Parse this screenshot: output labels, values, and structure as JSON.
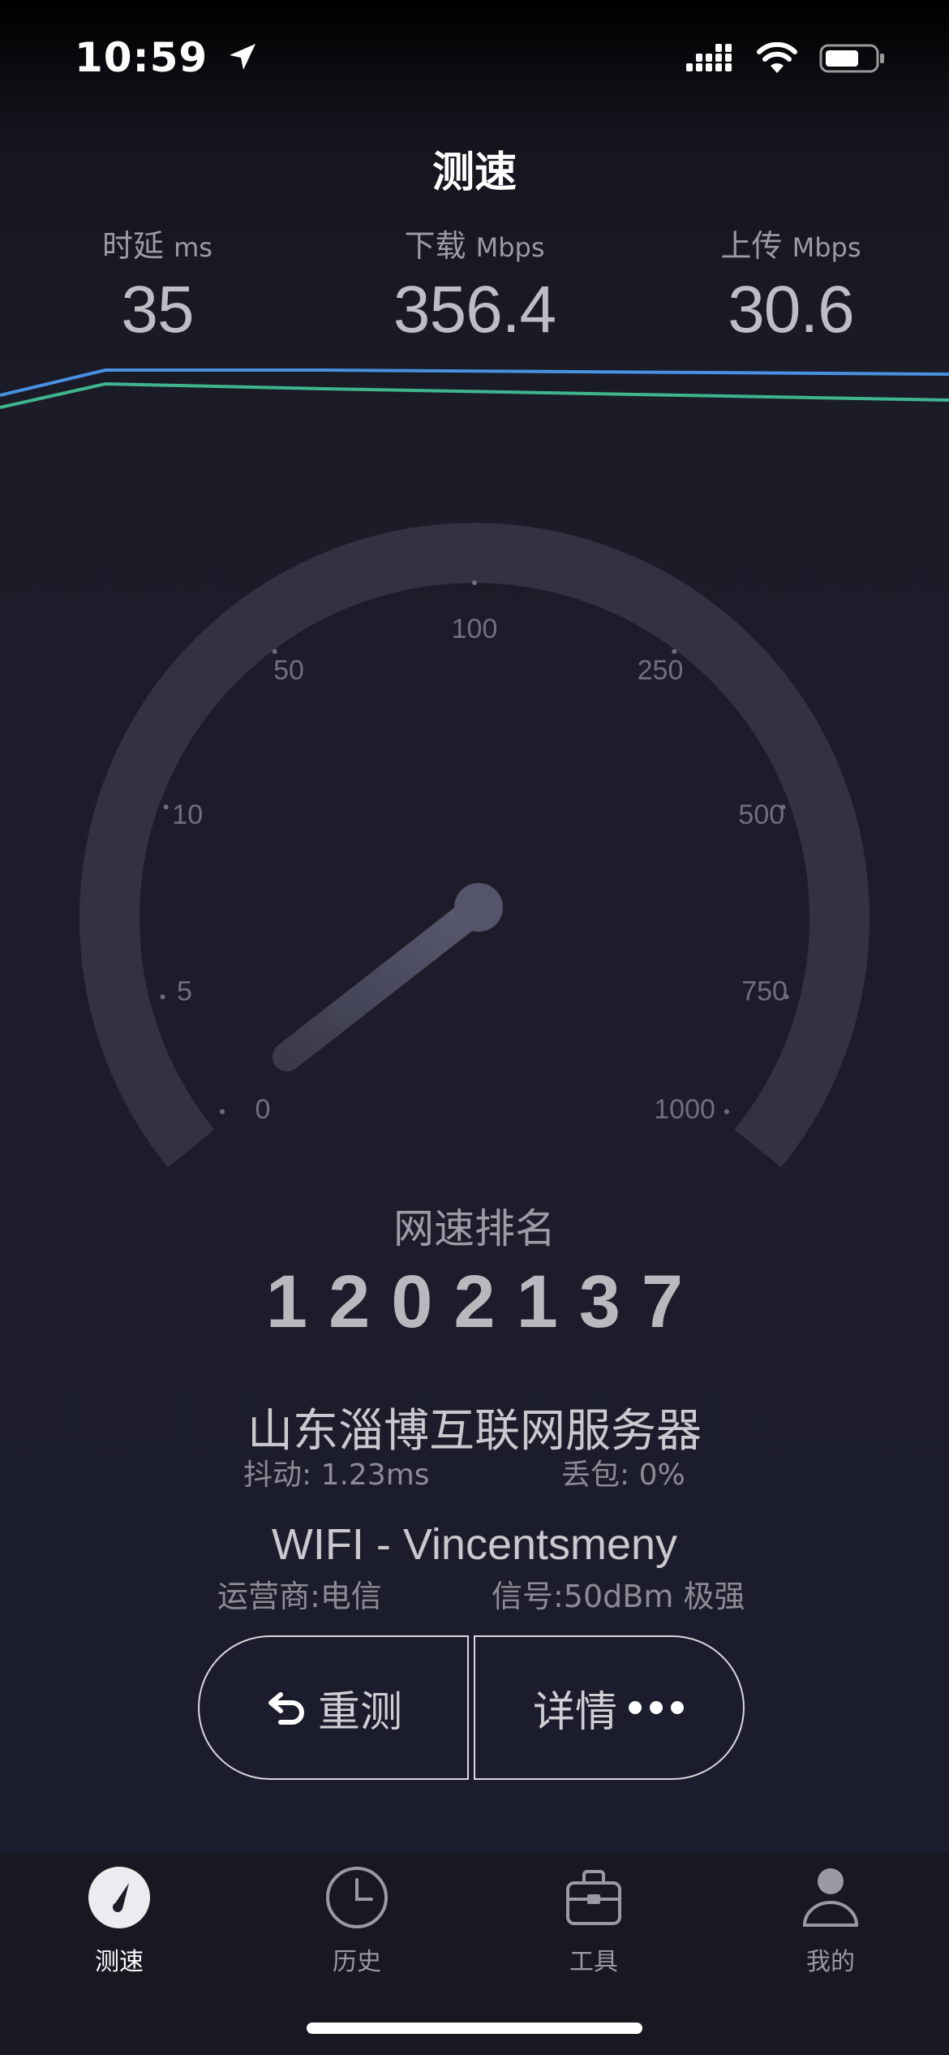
{
  "status_bar": {
    "time": "10:59"
  },
  "title": "测速",
  "metrics": [
    {
      "label": "时延",
      "unit": "ms",
      "value": "35"
    },
    {
      "label": "下载",
      "unit": "Mbps",
      "value": "356.4"
    },
    {
      "label": "上传",
      "unit": "Mbps",
      "value": "30.6"
    }
  ],
  "graph_colors": {
    "download": "#4a90e2",
    "upload": "#3fb58f"
  },
  "gauge": {
    "ticks": [
      "0",
      "5",
      "10",
      "50",
      "100",
      "250",
      "500",
      "750",
      "1000"
    ]
  },
  "rank": {
    "label": "网速排名",
    "value": "1202137"
  },
  "server": {
    "name": "山东淄博互联网服务器",
    "jitter": "抖动:  1.23ms",
    "loss": "丢包:   0%"
  },
  "network": {
    "name": "WIFI - Vincentsmeny",
    "carrier": "运营商:电信",
    "signal": "信号:50dBm 极强"
  },
  "buttons": {
    "retest": "重测",
    "detail": "详情"
  },
  "tabs": [
    {
      "label": "测速",
      "icon": "speedometer-icon",
      "active": true
    },
    {
      "label": "历史",
      "icon": "clock-icon",
      "active": false
    },
    {
      "label": "工具",
      "icon": "toolbox-icon",
      "active": false
    },
    {
      "label": "我的",
      "icon": "person-icon",
      "active": false
    }
  ]
}
